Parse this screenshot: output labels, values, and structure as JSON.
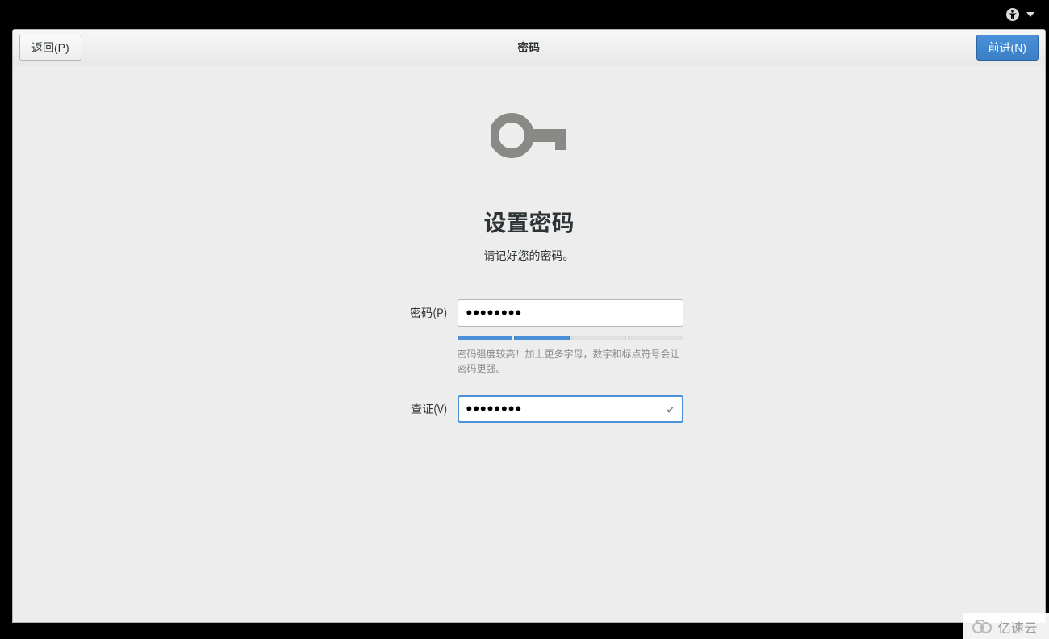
{
  "topbar": {
    "a11y_icon": "accessibility-icon"
  },
  "header": {
    "back_label": "返回(P)",
    "title": "密码",
    "next_label": "前进(N)"
  },
  "main": {
    "heading": "设置密码",
    "subheading": "请记好您的密码。",
    "password_label": "密码(P)",
    "password_value": "••••••••",
    "verify_label": "查证(V)",
    "verify_value": "••••••••",
    "strength_hint": "密码强度较高！加上更多字母，数字和标点符号会让密码更强。",
    "strength_filled_segments": 2,
    "strength_total_segments": 4
  },
  "watermark": {
    "text": "亿速云"
  }
}
